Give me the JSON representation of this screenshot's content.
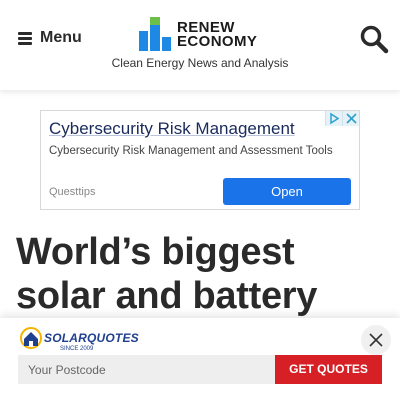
{
  "header": {
    "menu_label": "Menu",
    "logo_line1": "RENEW",
    "logo_line2": "ECONOMY",
    "tagline": "Clean Energy News and Analysis",
    "logo_colors": {
      "blue": "#1e88e5",
      "green": "#6cc04a"
    }
  },
  "ad": {
    "title": "Cybersecurity Risk Management",
    "description": "Cybersecurity Risk Management and Assessment Tools",
    "source": "Questtips",
    "cta": "Open",
    "cta_color": "#1a73e8"
  },
  "article": {
    "headline": "World’s biggest solar and battery project"
  },
  "banner": {
    "brand": "SOLARQUOTES",
    "brand_sub": "SINCE 2009",
    "postcode_placeholder": "Your Postcode",
    "cta": "GET QUOTES",
    "cta_color": "#d71f26"
  }
}
